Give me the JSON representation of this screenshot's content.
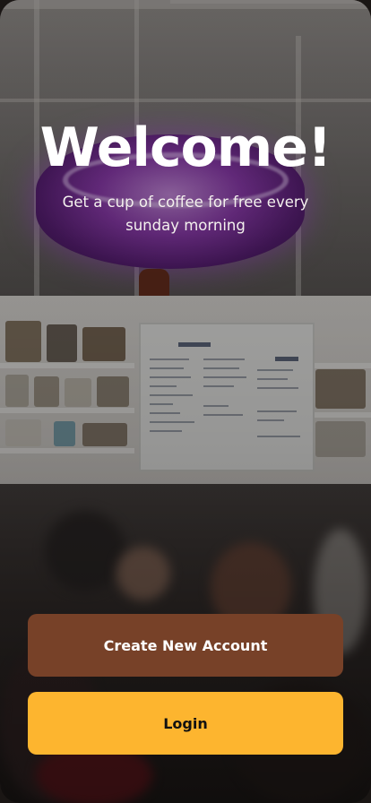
{
  "welcome": {
    "title": "Welcome!",
    "subtitle": "Get a cup of coffee for free every sunday morning"
  },
  "actions": {
    "create_account_label": "Create New Account",
    "login_label": "Login"
  },
  "colors": {
    "create_button": "#774128",
    "login_button": "#fdb52f",
    "title_text": "#ffffff"
  }
}
